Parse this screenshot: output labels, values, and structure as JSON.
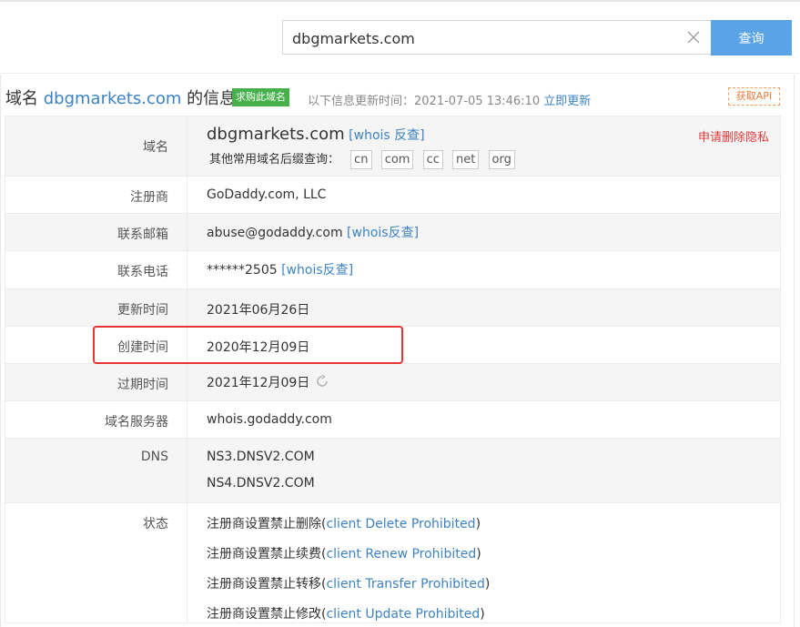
{
  "search": {
    "value": "dbgmarkets.com",
    "button_label": "查询"
  },
  "header": {
    "title_prefix": "域名 ",
    "domain": "dbgmarkets.com",
    "title_suffix": " 的信息",
    "buy_badge": "求购此域名",
    "update_prefix": "以下信息更新时间：",
    "update_time": "2021-07-05 13:46:10",
    "update_link": "立即更新",
    "api_button": "获取API"
  },
  "rows": {
    "domain": {
      "label": "域名",
      "value": "dbgmarkets.com",
      "whois_link": "[whois 反查]",
      "suffix_prompt": "其他常用域名后缀查询：",
      "tlds": [
        "cn",
        "com",
        "cc",
        "net",
        "org"
      ],
      "privacy_link": "申请删除隐私"
    },
    "registrar": {
      "label": "注册商",
      "value": "GoDaddy.com, LLC"
    },
    "email": {
      "label": "联系邮箱",
      "value": "abuse@godaddy.com",
      "whois_link": "[whois反查]"
    },
    "phone": {
      "label": "联系电话",
      "value": "******2505",
      "whois_link": "[whois反查]"
    },
    "updated": {
      "label": "更新时间",
      "value": "2021年06月26日"
    },
    "created": {
      "label": "创建时间",
      "value": "2020年12月09日"
    },
    "expires": {
      "label": "过期时间",
      "value": "2021年12月09日"
    },
    "whois_server": {
      "label": "域名服务器",
      "value": "whois.godaddy.com"
    },
    "dns": {
      "label": "DNS",
      "values": [
        "NS3.DNSV2.COM",
        "NS4.DNSV2.COM"
      ]
    },
    "status": {
      "label": "状态",
      "items": [
        {
          "text": "注册商设置禁止删除",
          "code": "client Delete Prohibited"
        },
        {
          "text": "注册商设置禁止续费",
          "code": "client Renew Prohibited"
        },
        {
          "text": "注册商设置禁止转移",
          "code": "client Transfer Prohibited"
        },
        {
          "text": "注册商设置禁止修改",
          "code": "client Update Prohibited"
        }
      ]
    }
  },
  "colors": {
    "accent": "#5aa3e6",
    "link": "#3d82c4",
    "badge": "#46b04a",
    "highlight": "#e53535",
    "privacy": "#e03a3a"
  }
}
